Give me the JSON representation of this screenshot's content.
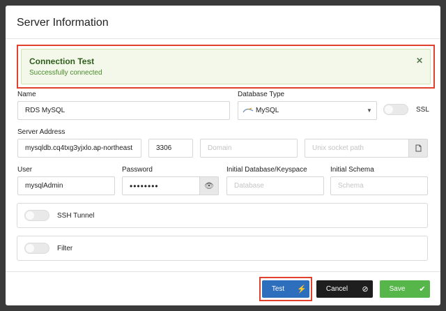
{
  "modal": {
    "title": "Server Information"
  },
  "alert": {
    "title": "Connection Test",
    "message": "Successfully connected",
    "close_icon": "close-icon"
  },
  "form": {
    "name_label": "Name",
    "name_value": "RDS MySQL",
    "db_type_label": "Database Type",
    "db_type_value": "MySQL",
    "ssl_label": "SSL",
    "server_address_label": "Server Address",
    "server_address_value": "mysqldb.cq4txg3yjxlo.ap-northeast",
    "port_value": "3306",
    "domain_placeholder": "Domain",
    "socket_placeholder": "Unix socket path",
    "user_label": "User",
    "user_value": "mysqlAdmin",
    "password_label": "Password",
    "password_value": "••••••••",
    "initial_db_label": "Initial Database/Keyspace",
    "initial_db_placeholder": "Database",
    "initial_schema_label": "Initial Schema",
    "initial_schema_placeholder": "Schema"
  },
  "panels": {
    "ssh_tunnel_label": "SSH Tunnel",
    "filter_label": "Filter"
  },
  "footer": {
    "test_label": "Test",
    "cancel_label": "Cancel",
    "save_label": "Save"
  },
  "colors": {
    "test": "#2d6fbd",
    "cancel": "#1e1e1e",
    "save": "#56b64a",
    "highlight": "#e0402c"
  }
}
